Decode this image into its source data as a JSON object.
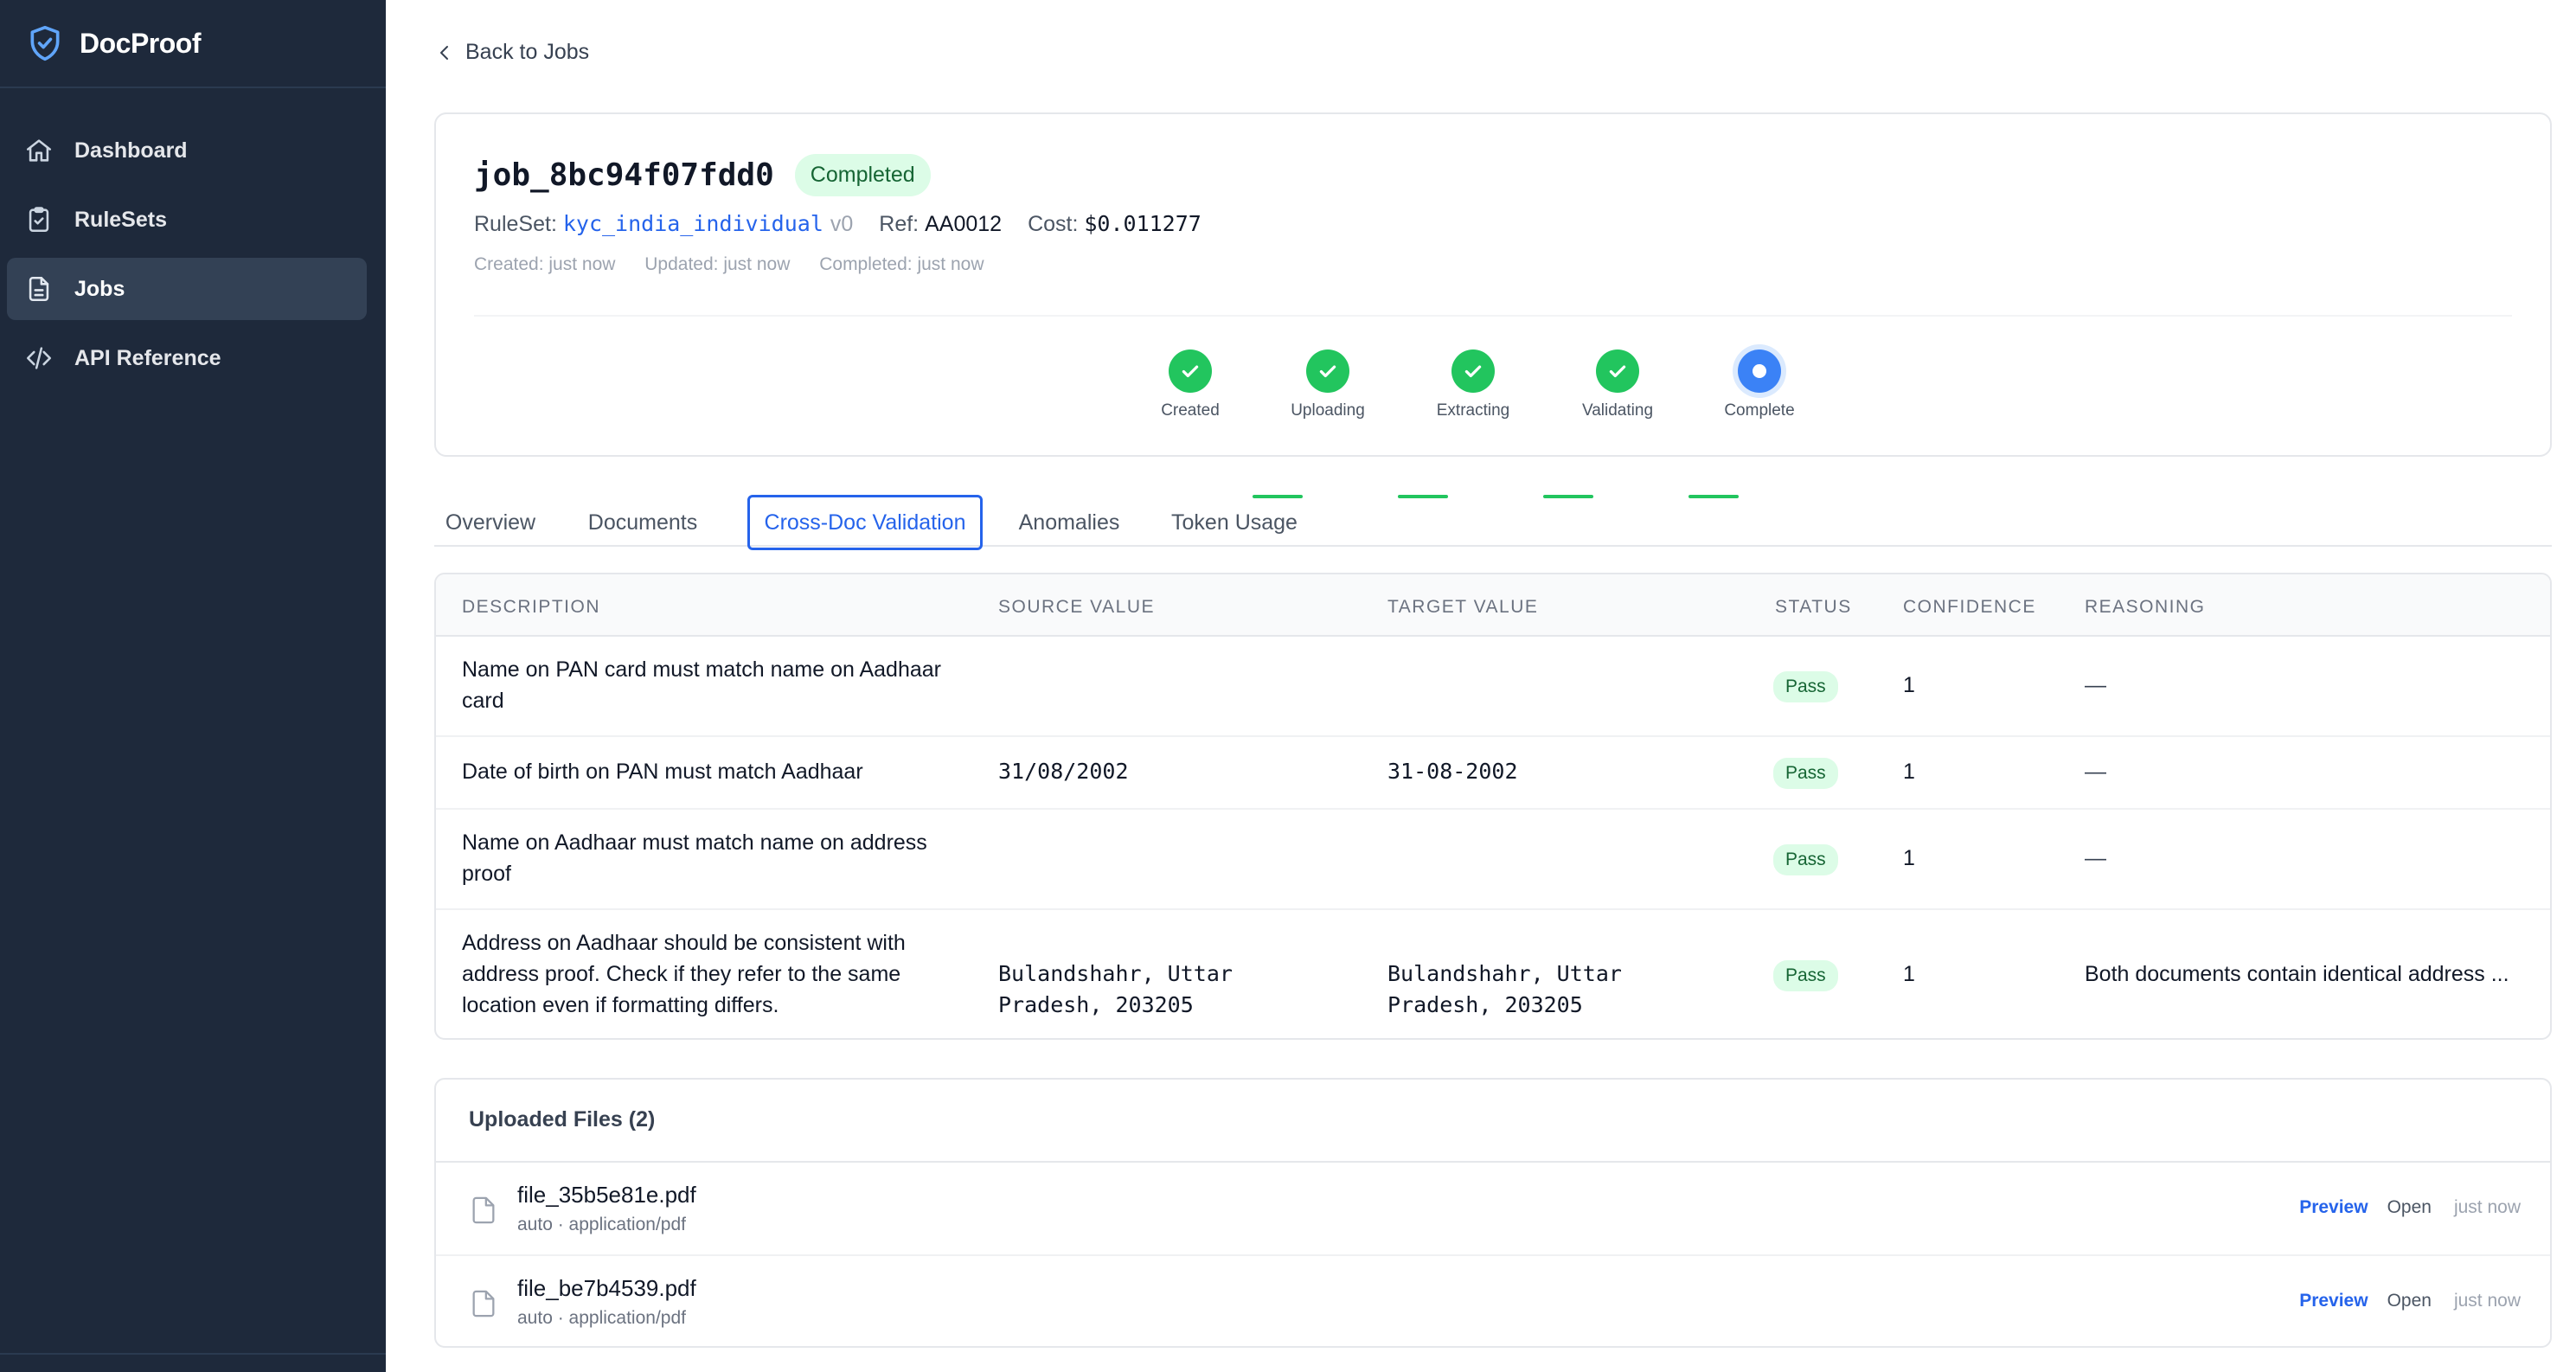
{
  "brand": {
    "name": "DocProof"
  },
  "sidebar": {
    "items": [
      {
        "label": "Dashboard",
        "icon": "home-icon",
        "active": false
      },
      {
        "label": "RuleSets",
        "icon": "clipboard-check-icon",
        "active": false
      },
      {
        "label": "Jobs",
        "icon": "document-icon",
        "active": true
      },
      {
        "label": "API Reference",
        "icon": "code-icon",
        "active": false
      }
    ]
  },
  "back_link": "Back to Jobs",
  "job": {
    "id": "job_8bc94f07fdd0",
    "status": "Completed",
    "ruleset_label": "RuleSet:",
    "ruleset_name": "kyc_india_individual",
    "ruleset_version": "v0",
    "ref_label": "Ref:",
    "ref_value": "AA0012",
    "cost_label": "Cost:",
    "cost_value": "$0.011277",
    "created": "Created: just now",
    "updated": "Updated: just now",
    "completed": "Completed: just now"
  },
  "steps": [
    {
      "label": "Created",
      "state": "done"
    },
    {
      "label": "Uploading",
      "state": "done"
    },
    {
      "label": "Extracting",
      "state": "done"
    },
    {
      "label": "Validating",
      "state": "done"
    },
    {
      "label": "Complete",
      "state": "current"
    }
  ],
  "tabs": [
    {
      "label": "Overview",
      "active": false
    },
    {
      "label": "Documents",
      "active": false
    },
    {
      "label": "Cross-Doc Validation",
      "active": true
    },
    {
      "label": "Anomalies",
      "active": false
    },
    {
      "label": "Token Usage",
      "active": false
    }
  ],
  "table": {
    "headers": [
      "Description",
      "Source Value",
      "Target Value",
      "Status",
      "Confidence",
      "Reasoning"
    ],
    "rows": [
      {
        "description": "Name on PAN card must match name on Aadhaar card",
        "source": "",
        "target": "",
        "status": "Pass",
        "confidence": "1",
        "reasoning": "—"
      },
      {
        "description": "Date of birth on PAN must match Aadhaar",
        "source": "31/08/2002",
        "target": "31-08-2002",
        "status": "Pass",
        "confidence": "1",
        "reasoning": "—"
      },
      {
        "description": "Name on Aadhaar must match name on address proof",
        "source": "",
        "target": "",
        "status": "Pass",
        "confidence": "1",
        "reasoning": "—"
      },
      {
        "description": "Address on Aadhaar should be consistent with address proof. Check if they refer to the same location even if formatting differs.",
        "source": "Bulandshahr, Uttar Pradesh, 203205",
        "target": "Bulandshahr, Uttar Pradesh, 203205",
        "status": "Pass",
        "confidence": "1",
        "reasoning": "Both documents contain identical address ..."
      }
    ]
  },
  "files": {
    "title": "Uploaded Files (2)",
    "items": [
      {
        "name": "file_35b5e81e.pdf",
        "meta": "auto · application/pdf",
        "preview": "Preview",
        "open": "Open",
        "time": "just now"
      },
      {
        "name": "file_be7b4539.pdf",
        "meta": "auto · application/pdf",
        "preview": "Preview",
        "open": "Open",
        "time": "just now"
      }
    ]
  },
  "colors": {
    "sidebar": "#1e293b",
    "accent": "#2563eb",
    "success": "#22c55e",
    "current": "#3b82f6"
  }
}
